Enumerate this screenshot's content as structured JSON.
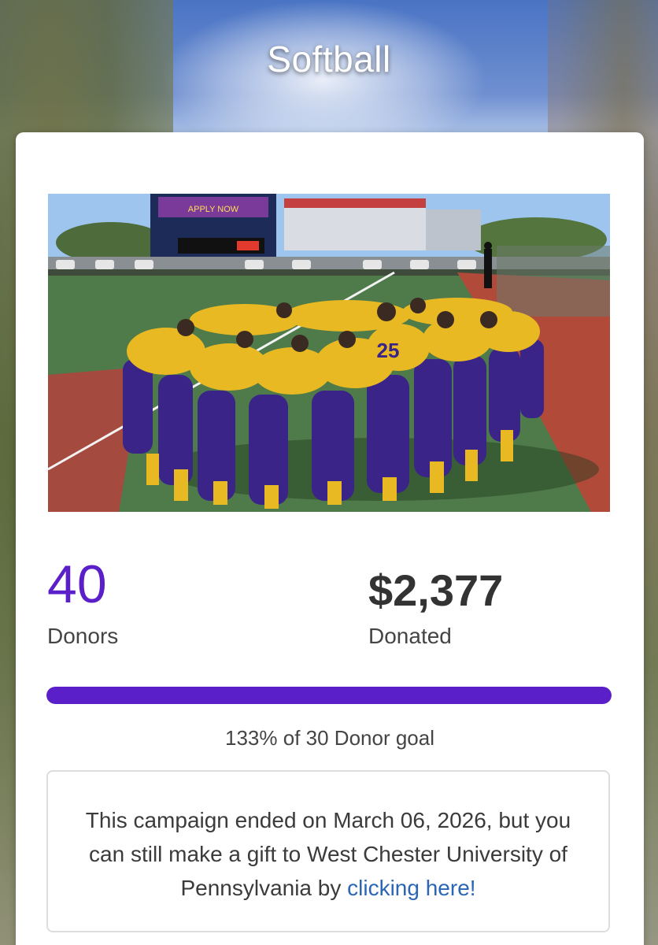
{
  "page": {
    "title": "Softball"
  },
  "stats": {
    "donors_value": "40",
    "donors_label": "Donors",
    "donated_value": "$2,377",
    "donated_label": "Donated"
  },
  "progress": {
    "fraction": 1.0,
    "goal_text": "133% of 30 Donor goal"
  },
  "campaign_notice": {
    "text": "This campaign ended on March 06, 2026, but you can still make a gift to West Chester University of Pennsylvania by ",
    "link_text": "clicking here!"
  },
  "photo": {
    "scoreboard_text": "APPLY NOW",
    "jersey_number": "25"
  },
  "colors": {
    "accent": "#5a1fc8",
    "link": "#2a66b5",
    "team_gold": "#e8b923",
    "team_purple": "#3a2487"
  }
}
